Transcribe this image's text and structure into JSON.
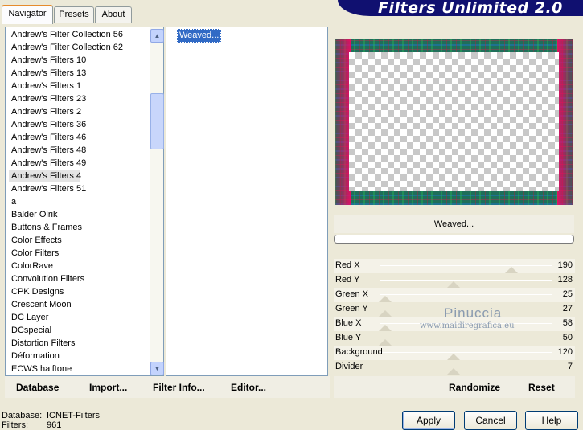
{
  "tabs": [
    {
      "label": "Navigator",
      "active": true
    },
    {
      "label": "Presets",
      "active": false
    },
    {
      "label": "About",
      "active": false
    }
  ],
  "banner_title": "Filters Unlimited 2.0",
  "filter_list": {
    "items": [
      "Andrew's Filter Collection 56",
      "Andrew's Filter Collection 62",
      "Andrew's Filters 10",
      "Andrew's Filters 13",
      "Andrew's Filters 1",
      "Andrew's Filters 23",
      "Andrew's Filters 2",
      "Andrew's Filters 36",
      "Andrew's Filters 46",
      "Andrew's Filters 48",
      "Andrew's Filters 49",
      "Andrew's Filters 4",
      "Andrew's Filters 51",
      "a",
      "Balder Olrik",
      "Buttons & Frames",
      "Color Effects",
      "Color Filters",
      "ColorRave",
      "Convolution Filters",
      "CPK Designs",
      "Crescent Moon",
      "DC Layer",
      "DCspecial",
      "Distortion Filters",
      "Déformation",
      "ECWS halftone"
    ],
    "selected": "Andrew's Filters 4"
  },
  "effects_list": {
    "items": [
      "Weaved..."
    ],
    "selected": "Weaved..."
  },
  "effect_name": "Weaved...",
  "sliders": [
    {
      "label": "Red X",
      "value": "190"
    },
    {
      "label": "Red Y",
      "value": "128"
    },
    {
      "label": "Green X",
      "value": "25"
    },
    {
      "label": "Green Y",
      "value": "27"
    },
    {
      "label": "Blue X",
      "value": "58"
    },
    {
      "label": "Blue Y",
      "value": "50"
    },
    {
      "label": "Background",
      "value": "120"
    },
    {
      "label": "Divider",
      "value": "7"
    }
  ],
  "watermark": {
    "name": "Pinuccia",
    "url": "www.maidiregrafica.eu"
  },
  "toolbar_left": {
    "database": "Database",
    "import": "Import...",
    "filter_info": "Filter Info...",
    "editor": "Editor..."
  },
  "toolbar_right": {
    "randomize": "Randomize",
    "reset": "Reset"
  },
  "status": {
    "database_label": "Database:",
    "database_value": "ICNET-Filters",
    "filters_label": "Filters:",
    "filters_value": "961"
  },
  "buttons": {
    "apply": "Apply",
    "cancel": "Cancel",
    "help": "Help"
  }
}
